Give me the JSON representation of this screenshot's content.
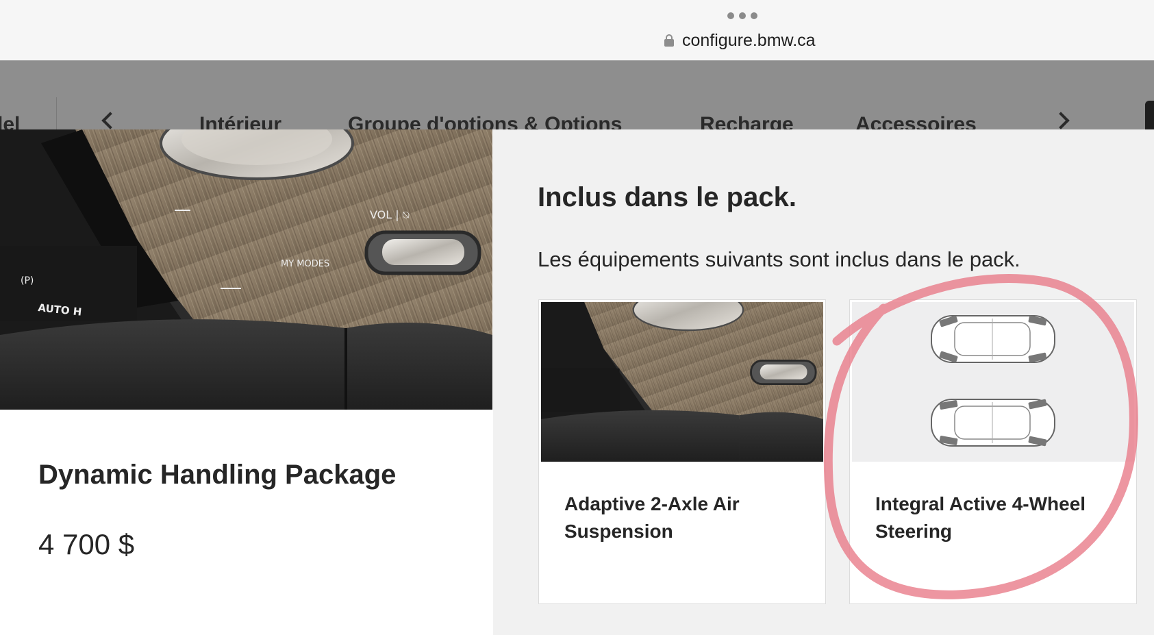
{
  "browser": {
    "url": "configure.bmw.ca"
  },
  "nav": {
    "tabs": [
      "lel",
      "Intérieur",
      "Groupe d'options & Options",
      "Recharge",
      "Accessoires"
    ]
  },
  "package": {
    "title": "Dynamic Handling Package",
    "price": "4 700 $",
    "image_texts": [
      "VOL | ⍉",
      "MY MODES",
      "AUTO H",
      "(P)"
    ]
  },
  "included": {
    "title": "Inclus dans le pack.",
    "subtitle": "Les équipements suivants sont inclus dans le pack.",
    "items": [
      {
        "label": "Adaptive 2-Axle Air Suspension"
      },
      {
        "label": "Integral Active 4-Wheel Steering"
      }
    ]
  },
  "annotation": {
    "color": "#e97c89"
  }
}
